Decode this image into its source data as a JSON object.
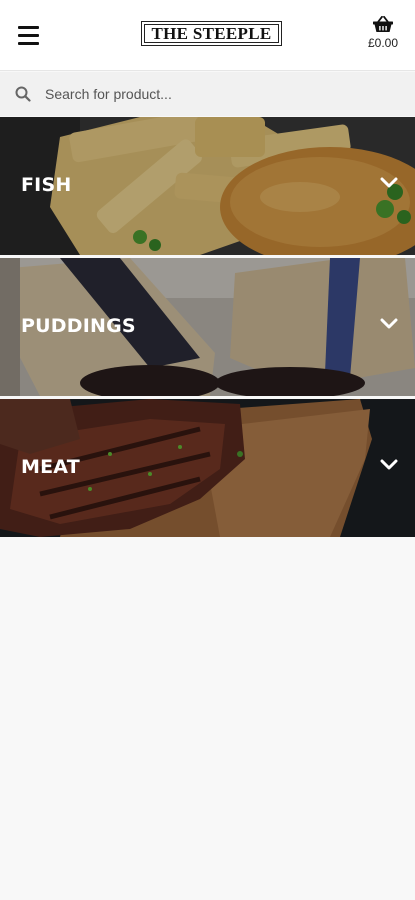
{
  "header": {
    "logo_text": "THE STEEPLE",
    "cart_total": "£0.00"
  },
  "search": {
    "placeholder": "Search for product..."
  },
  "categories": [
    {
      "label": "FISH"
    },
    {
      "label": "PUDDINGS"
    },
    {
      "label": "MEAT"
    }
  ],
  "icons": {
    "menu": "hamburger-icon",
    "cart": "basket-icon",
    "search": "search-icon",
    "expand": "chevron-down-icon"
  },
  "colors": {
    "header_bg": "#ffffff",
    "search_bg": "#f1f1f1",
    "page_bg": "#f8f8f8",
    "category_text": "#ffffff"
  }
}
